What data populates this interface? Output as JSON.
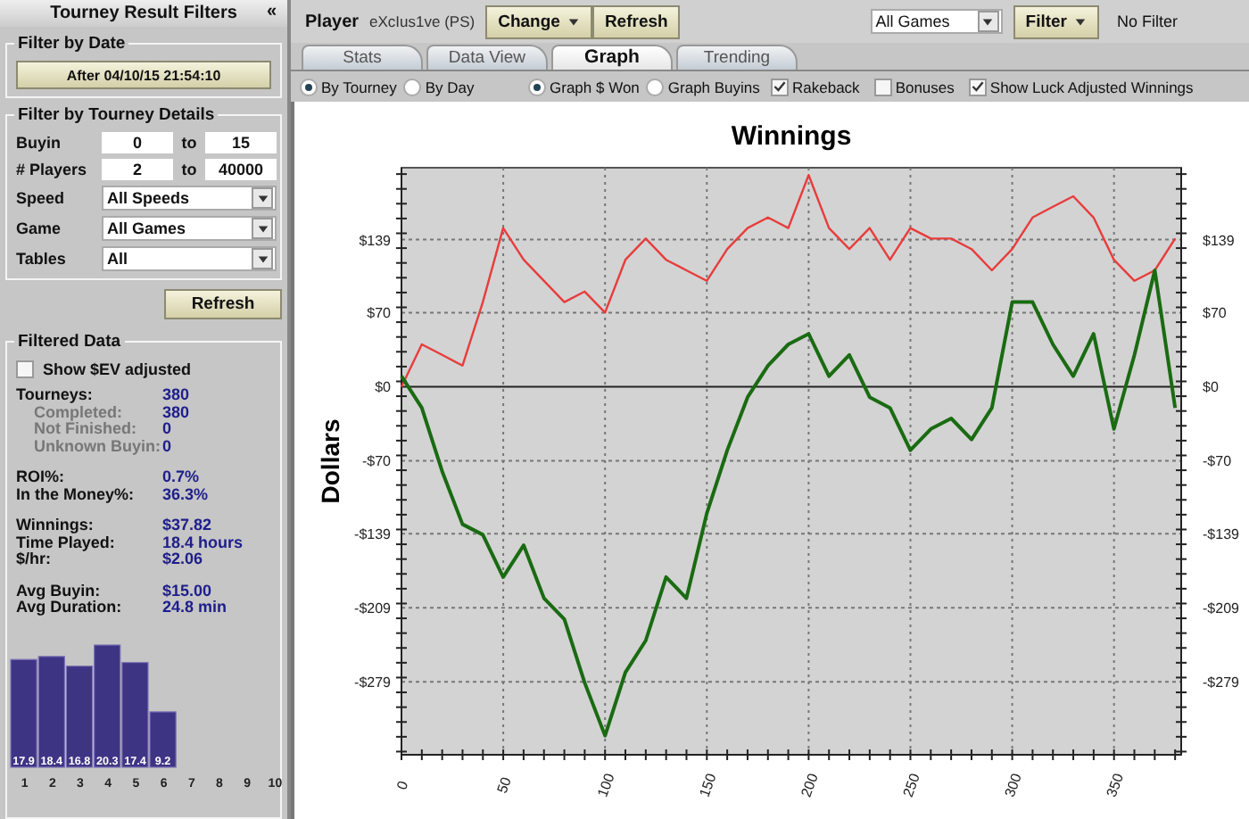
{
  "sidebar": {
    "title": "Tourney Result Filters",
    "collapse": "«",
    "date_filter": {
      "legend": "Filter by Date",
      "button": "After 04/10/15 21:54:10"
    },
    "details": {
      "legend": "Filter by Tourney Details",
      "ranges": [
        {
          "label": "Buyin",
          "from": "0",
          "sep": "to",
          "to": "15"
        },
        {
          "label": "# Players",
          "from": "2",
          "sep": "to",
          "to": "40000"
        }
      ],
      "selects": [
        {
          "label": "Speed",
          "value": "All Speeds"
        },
        {
          "label": "Game",
          "value": "All Games"
        },
        {
          "label": "Tables",
          "value": "All"
        }
      ]
    },
    "refresh": "Refresh",
    "filtered": {
      "legend": "Filtered Data",
      "ev_checkbox": {
        "label": "Show $EV adjusted",
        "checked": false
      },
      "groups": [
        [
          {
            "kind": "main",
            "label": "Tourneys:",
            "value": "380"
          },
          {
            "kind": "sub",
            "label": "Completed:",
            "value": "380"
          },
          {
            "kind": "sub",
            "label": "Not Finished:",
            "value": "0"
          },
          {
            "kind": "sub",
            "label": "Unknown Buyin:",
            "value": "0"
          }
        ],
        [
          {
            "kind": "main",
            "label": "ROI%:",
            "value": "0.7%"
          },
          {
            "kind": "main",
            "label": "In the Money%:",
            "value": "36.3%"
          }
        ],
        [
          {
            "kind": "main",
            "label": "Winnings:",
            "value": "$37.82"
          },
          {
            "kind": "main",
            "label": "Time Played:",
            "value": "18.4 hours"
          },
          {
            "kind": "main",
            "label": "$/hr:",
            "value": "$2.06"
          }
        ],
        [
          {
            "kind": "main",
            "label": "Avg Buyin:",
            "value": "$15.00"
          },
          {
            "kind": "main",
            "label": "Avg Duration:",
            "value": "24.8 min"
          }
        ]
      ],
      "histogram": {
        "chart_data": {
          "type": "bar",
          "categories": [
            "1",
            "2",
            "3",
            "4",
            "5",
            "6",
            "7",
            "8",
            "9",
            "10"
          ],
          "values": [
            17.9,
            18.4,
            16.8,
            20.3,
            17.4,
            9.2,
            null,
            null,
            null,
            null
          ],
          "value_labels": [
            "17.9",
            "18.4",
            "16.8",
            "20.3",
            "17.4",
            "9.2",
            null,
            null,
            null,
            null
          ]
        }
      }
    }
  },
  "toolbar": {
    "player_label": "Player",
    "player_name": "eXcIus1ve (PS)",
    "change": "Change",
    "refresh": "Refresh",
    "games": "All Games",
    "filter": "Filter",
    "filter_status": "No Filter"
  },
  "tabs": [
    {
      "label": "Stats",
      "selected": false
    },
    {
      "label": "Data View",
      "selected": false
    },
    {
      "label": "Graph",
      "selected": true
    },
    {
      "label": "Trending",
      "selected": false
    }
  ],
  "options": {
    "radio_groups": [
      [
        {
          "label": "By Tourney",
          "selected": true
        },
        {
          "label": "By Day",
          "selected": false
        }
      ],
      [
        {
          "label": "Graph $ Won",
          "selected": true
        },
        {
          "label": "Graph Buyins",
          "selected": false
        }
      ]
    ],
    "checkboxes": [
      {
        "label": "Rakeback",
        "checked": true
      },
      {
        "label": "Bonuses",
        "checked": false
      },
      {
        "label": "Show Luck Adjusted Winnings",
        "checked": true
      }
    ]
  },
  "graph": {
    "chart_data": {
      "type": "line",
      "title": "Winnings",
      "ylabel": "Dollars",
      "xlim": [
        0,
        383
      ],
      "ylim": [
        -348,
        207
      ],
      "x": [
        0,
        10,
        20,
        30,
        40,
        50,
        60,
        70,
        80,
        90,
        100,
        110,
        120,
        130,
        140,
        150,
        160,
        170,
        180,
        190,
        200,
        210,
        220,
        230,
        240,
        250,
        260,
        270,
        280,
        290,
        300,
        310,
        320,
        330,
        340,
        350,
        360,
        370,
        380
      ],
      "series": [
        {
          "color": "#e83c3c",
          "values": [
            0,
            40,
            30,
            20,
            80,
            150,
            120,
            100,
            80,
            90,
            70,
            120,
            140,
            120,
            110,
            100,
            130,
            150,
            160,
            150,
            200,
            150,
            130,
            150,
            120,
            150,
            140,
            140,
            130,
            110,
            130,
            160,
            170,
            180,
            160,
            120,
            100,
            110,
            140
          ]
        },
        {
          "color": "#1a6b12",
          "values": [
            10,
            -20,
            -80,
            -130,
            -140,
            -180,
            -150,
            -200,
            -220,
            -280,
            -330,
            -270,
            -240,
            -180,
            -200,
            -120,
            -60,
            -10,
            20,
            40,
            50,
            10,
            30,
            -10,
            -20,
            -60,
            -40,
            -30,
            -50,
            -20,
            80,
            80,
            40,
            10,
            50,
            -40,
            30,
            110,
            -20
          ]
        }
      ],
      "grid": true,
      "xticks": [
        0,
        50,
        100,
        150,
        200,
        250,
        300,
        350
      ],
      "yticks": [
        {
          "value": 139,
          "label": "$139"
        },
        {
          "value": 70,
          "label": "$70"
        },
        {
          "value": 0,
          "label": "$0"
        },
        {
          "value": -70,
          "label": "-$70"
        },
        {
          "value": -139,
          "label": "-$139"
        },
        {
          "value": -209,
          "label": "-$209"
        },
        {
          "value": -279,
          "label": "-$279"
        }
      ]
    }
  }
}
